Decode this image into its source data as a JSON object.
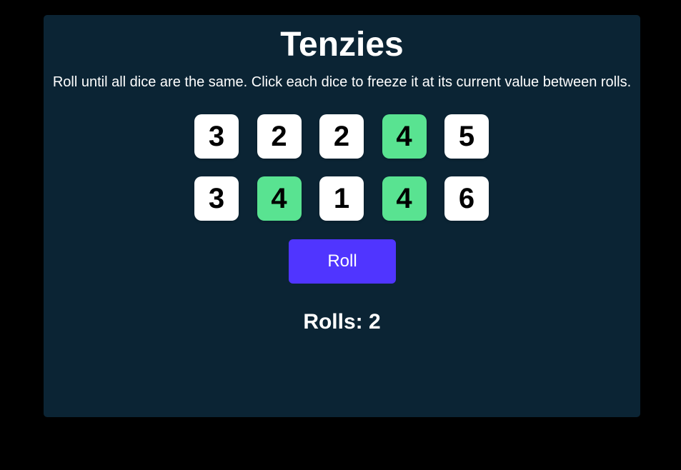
{
  "title": "Tenzies",
  "instructions": "Roll until all dice are the same. Click each dice to freeze it at its current value between rolls.",
  "dice": [
    {
      "value": "3",
      "held": false
    },
    {
      "value": "2",
      "held": false
    },
    {
      "value": "2",
      "held": false
    },
    {
      "value": "4",
      "held": true
    },
    {
      "value": "5",
      "held": false
    },
    {
      "value": "3",
      "held": false
    },
    {
      "value": "4",
      "held": true
    },
    {
      "value": "1",
      "held": false
    },
    {
      "value": "4",
      "held": true
    },
    {
      "value": "6",
      "held": false
    }
  ],
  "roll_button_label": "Roll",
  "rolls_text": "Rolls: 2",
  "colors": {
    "page_background": "#000000",
    "panel_background": "#0b2434",
    "die_default": "#ffffff",
    "die_held": "#59e391",
    "button": "#5035ff"
  }
}
